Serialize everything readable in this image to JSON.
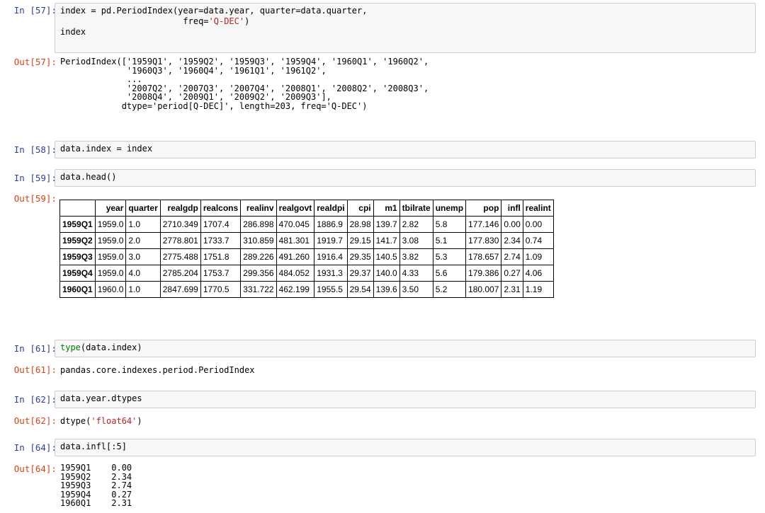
{
  "cells": {
    "c57": {
      "in_prompt": "In [57]:",
      "code_l1_a": "index = pd.PeriodIndex(year=data.year, quarter=data.quarter,",
      "code_l2_a": "                        freq=",
      "code_l2_s": "'Q-DEC'",
      "code_l2_b": ")",
      "code_l3": "index",
      "out_prompt": "Out[57]:",
      "output": "PeriodIndex(['1959Q1', '1959Q2', '1959Q3', '1959Q4', '1960Q1', '1960Q2',\n             '1960Q3', '1960Q4', '1961Q1', '1961Q2',\n             ...\n             '2007Q2', '2007Q3', '2007Q4', '2008Q1', '2008Q2', '2008Q3',\n             '2008Q4', '2009Q1', '2009Q2', '2009Q3'],\n            dtype='period[Q-DEC]', length=203, freq='Q-DEC')"
    },
    "c58": {
      "in_prompt": "In [58]:",
      "code": "data.index = index"
    },
    "c59": {
      "in_prompt": "In [59]:",
      "code": "data.head()",
      "out_prompt": "Out[59]:"
    },
    "c61": {
      "in_prompt": "In [61]:",
      "code_fn": "type",
      "code_rest": "(data.index)",
      "out_prompt": "Out[61]:",
      "output": "pandas.core.indexes.period.PeriodIndex"
    },
    "c62": {
      "in_prompt": "In [62]:",
      "code": "data.year.dtypes",
      "out_prompt": "Out[62]:",
      "output_a": "dtype(",
      "output_s": "'float64'",
      "output_b": ")"
    },
    "c64": {
      "in_prompt": "In [64]:",
      "code": "data.infl[:5]",
      "out_prompt": "Out[64]:",
      "output": "1959Q1    0.00\n1959Q2    2.34\n1959Q3    2.74\n1959Q4    0.27\n1960Q1    2.31"
    }
  },
  "dataframe": {
    "columns": [
      "",
      "year",
      "quarter",
      "realgdp",
      "realcons",
      "realinv",
      "realgovt",
      "realdpi",
      "cpi",
      "m1",
      "tbilrate",
      "unemp",
      "pop",
      "infl",
      "realint"
    ],
    "rows": [
      [
        "1959Q1",
        "1959.0",
        "1.0",
        "2710.349",
        "1707.4",
        "286.898",
        "470.045",
        "1886.9",
        "28.98",
        "139.7",
        "2.82",
        "5.8",
        "177.146",
        "0.00",
        "0.00"
      ],
      [
        "1959Q2",
        "1959.0",
        "2.0",
        "2778.801",
        "1733.7",
        "310.859",
        "481.301",
        "1919.7",
        "29.15",
        "141.7",
        "3.08",
        "5.1",
        "177.830",
        "2.34",
        "0.74"
      ],
      [
        "1959Q3",
        "1959.0",
        "3.0",
        "2775.488",
        "1751.8",
        "289.226",
        "491.260",
        "1916.4",
        "29.35",
        "140.5",
        "3.82",
        "5.3",
        "178.657",
        "2.74",
        "1.09"
      ],
      [
        "1959Q4",
        "1959.0",
        "4.0",
        "2785.204",
        "1753.7",
        "299.356",
        "484.052",
        "1931.3",
        "29.37",
        "140.0",
        "4.33",
        "5.6",
        "179.386",
        "0.27",
        "4.06"
      ],
      [
        "1960Q1",
        "1960.0",
        "1.0",
        "2847.699",
        "1770.5",
        "331.722",
        "462.199",
        "1955.5",
        "29.54",
        "139.6",
        "3.50",
        "5.2",
        "180.007",
        "2.31",
        "1.19"
      ]
    ]
  },
  "colors": {
    "in_prompt": "#303f9f",
    "out_prompt": "#d84315",
    "string": "#ba2121",
    "builtin": "#008000",
    "input_bg": "#f7f7f7",
    "input_border": "#cfcfcf"
  }
}
